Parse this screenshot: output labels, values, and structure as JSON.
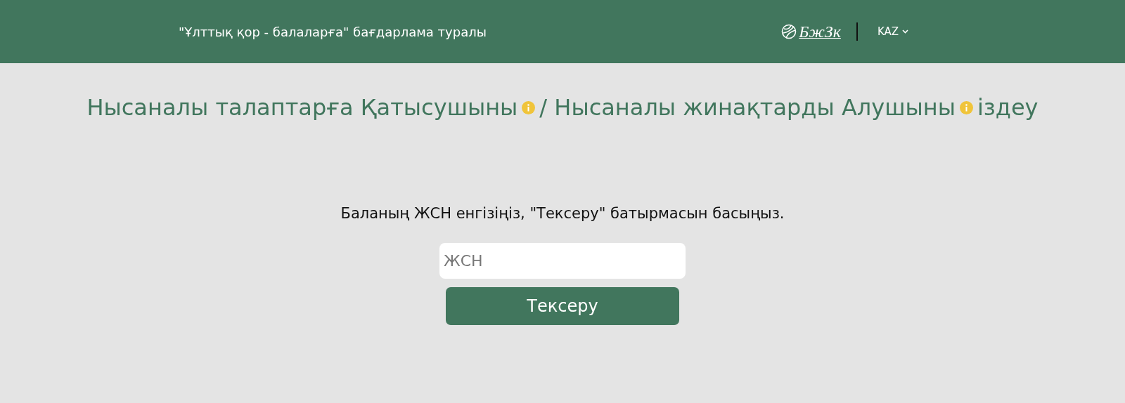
{
  "header": {
    "program_link": "\"Ұлттық қор - балаларға\" бағдарлама туралы",
    "logo_text": "БжЗк",
    "language": "KAZ"
  },
  "heading": [
    {
      "text": "Нысаналы талаптарға Қатысушыны",
      "info": true
    },
    {
      "text": "/ Нысаналы жинақтарды Алушыны",
      "info": true
    },
    {
      "text": "іздеу",
      "info": false
    }
  ],
  "instruction": "Баланың ЖСН енгізіңіз, \"Тексеру\" батырмасын басыңыз.",
  "iin_field": {
    "placeholder": "ЖСН"
  },
  "check_button": "Тексеру"
}
